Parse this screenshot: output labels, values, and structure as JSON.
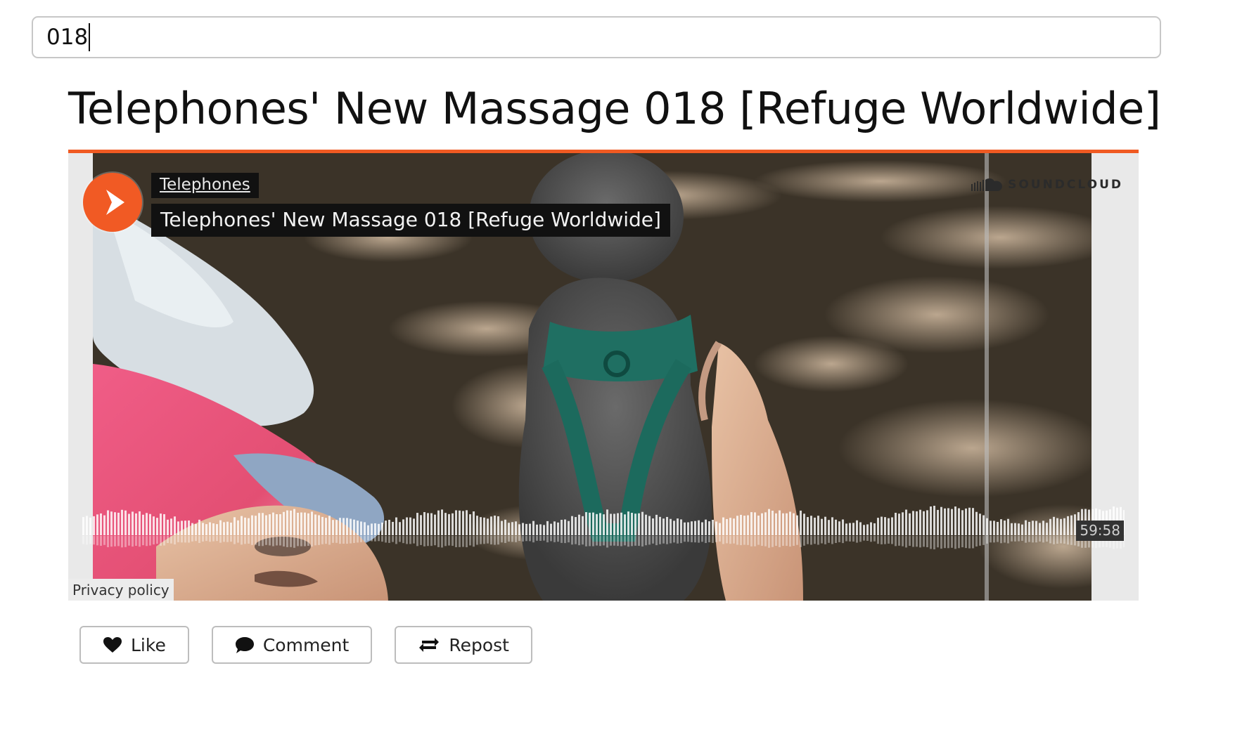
{
  "search": {
    "value": "018"
  },
  "page_title": "Telephones' New Massage 018 [Refuge Worldwide]",
  "player": {
    "artist": "Telephones",
    "track_title": "Telephones' New Massage 018 [Refuge Worldwide]",
    "brand": "SOUNDCLOUD",
    "duration": "59:58",
    "privacy_label": "Privacy policy",
    "play_icon": "play-icon",
    "accent_color": "#f15a24"
  },
  "actions": {
    "like": "Like",
    "comment": "Comment",
    "repost": "Repost"
  }
}
